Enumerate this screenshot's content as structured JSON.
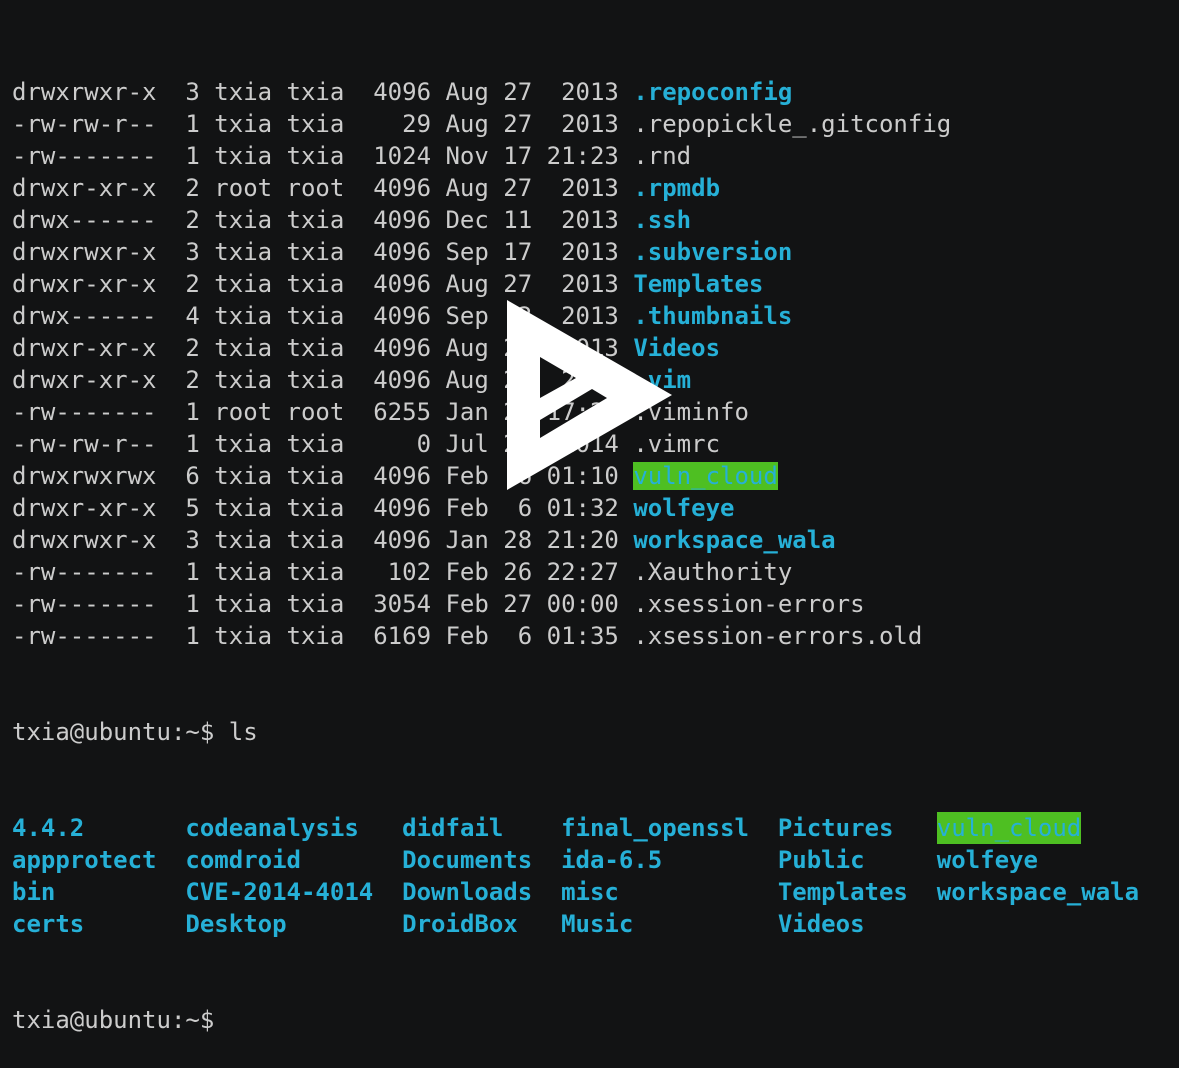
{
  "listing": [
    {
      "meta": "drwxrwxr-x  3 txia txia  4096 Aug 27  2013 ",
      "name": ".repoconfig",
      "type": "dir"
    },
    {
      "meta": "-rw-rw-r--  1 txia txia    29 Aug 27  2013 ",
      "name": ".repopickle_.gitconfig",
      "type": "file"
    },
    {
      "meta": "-rw-------  1 txia txia  1024 Nov 17 21:23 ",
      "name": ".rnd",
      "type": "file"
    },
    {
      "meta": "drwxr-xr-x  2 root root  4096 Aug 27  2013 ",
      "name": ".rpmdb",
      "type": "dir"
    },
    {
      "meta": "drwx------  2 txia txia  4096 Dec 11  2013 ",
      "name": ".ssh",
      "type": "dir"
    },
    {
      "meta": "drwxrwxr-x  3 txia txia  4096 Sep 17  2013 ",
      "name": ".subversion",
      "type": "dir"
    },
    {
      "meta": "drwxr-xr-x  2 txia txia  4096 Aug 27  2013 ",
      "name": "Templates",
      "type": "dir"
    },
    {
      "meta": "drwx------  4 txia txia  4096 Sep  2  2013 ",
      "name": ".thumbnails",
      "type": "dir"
    },
    {
      "meta": "drwxr-xr-x  2 txia txia  4096 Aug 27  2013 ",
      "name": "Videos",
      "type": "dir"
    },
    {
      "meta": "drwxr-xr-x  2 txia txia  4096 Aug 24  2014 ",
      "name": ".vim",
      "type": "dir"
    },
    {
      "meta": "-rw-------  1 root root  6255 Jan 22 17:28 ",
      "name": ".viminfo",
      "type": "file"
    },
    {
      "meta": "-rw-rw-r--  1 txia txia     0 Jul 22  2014 ",
      "name": ".vimrc",
      "type": "file"
    },
    {
      "meta": "drwxrwxrwx  6 txia txia  4096 Feb  6 01:10 ",
      "name": "vuln_cloud",
      "type": "hl"
    },
    {
      "meta": "drwxr-xr-x  5 txia txia  4096 Feb  6 01:32 ",
      "name": "wolfeye",
      "type": "dir"
    },
    {
      "meta": "drwxrwxr-x  3 txia txia  4096 Jan 28 21:20 ",
      "name": "workspace_wala",
      "type": "dir"
    },
    {
      "meta": "-rw-------  1 txia txia   102 Feb 26 22:27 ",
      "name": ".Xauthority",
      "type": "file"
    },
    {
      "meta": "-rw-------  1 txia txia  3054 Feb 27 00:00 ",
      "name": ".xsession-errors",
      "type": "file"
    },
    {
      "meta": "-rw-------  1 txia txia  6169 Feb  6 01:35 ",
      "name": ".xsession-errors.old",
      "type": "file"
    }
  ],
  "prompt1": "txia@ubuntu:~$ ls",
  "ls_rows": [
    [
      "4.4.2",
      "codeanalysis",
      "didfail",
      "final_openssl",
      "Pictures",
      "vuln_cloud"
    ],
    [
      "appprotect",
      "comdroid",
      "Documents",
      "ida-6.5",
      "Public",
      "wolfeye"
    ],
    [
      "bin",
      "CVE-2014-4014",
      "Downloads",
      "misc",
      "Templates",
      "workspace_wala"
    ],
    [
      "certs",
      "Desktop",
      "DroidBox",
      "Music",
      "Videos",
      ""
    ]
  ],
  "prompt2": "txia@ubuntu:~$ ",
  "colors": {
    "bg": "#121314",
    "text": "#cccccc",
    "dir": "#26b0d7",
    "highlight": "#4ebf22"
  },
  "overlay_icon": "play-icon"
}
